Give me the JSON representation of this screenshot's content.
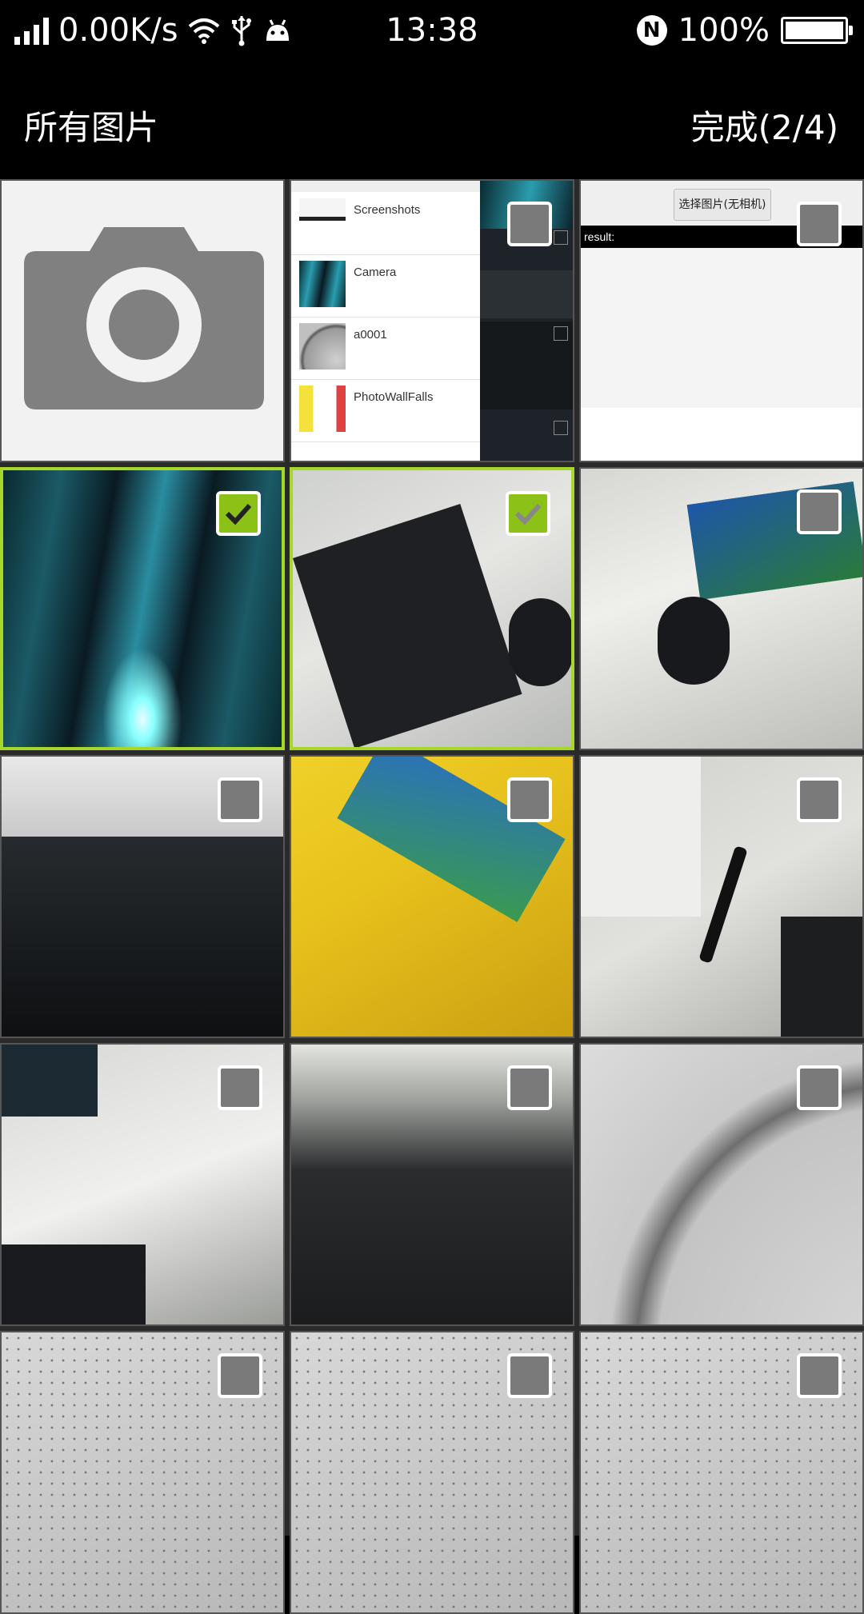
{
  "status_bar": {
    "net_speed": "0.00K/s",
    "time": "13:38",
    "battery": "100%",
    "battery_level": 1.0,
    "nfc_label": "N",
    "icons": [
      "signal-icon",
      "wifi-icon",
      "usb-icon",
      "android-debug-icon",
      "nfc-icon",
      "battery-icon"
    ]
  },
  "header": {
    "title": "所有图片",
    "done_label": "完成(2/4)"
  },
  "grid": {
    "camera_tile": {
      "icon": "camera-icon"
    },
    "album_screenshot": {
      "albums": [
        "Screenshots",
        "Camera",
        "a0001",
        "PhotoWallFalls"
      ]
    },
    "result_screenshot": {
      "button_label": "选择图片(无相机)",
      "result_label": "result:"
    },
    "photos": [
      {
        "selected": true
      },
      {
        "selected": true
      },
      {
        "selected": false
      },
      {
        "selected": false
      },
      {
        "selected": false
      },
      {
        "selected": false
      },
      {
        "selected": false
      },
      {
        "selected": false
      },
      {
        "selected": false
      },
      {
        "selected": false
      },
      {
        "selected": false
      },
      {
        "selected": false
      }
    ]
  },
  "colors": {
    "selected_border": "#a5d82b",
    "checkbox_checked": "#8cc218",
    "checkbox_unchecked": "#7a7a7a"
  }
}
